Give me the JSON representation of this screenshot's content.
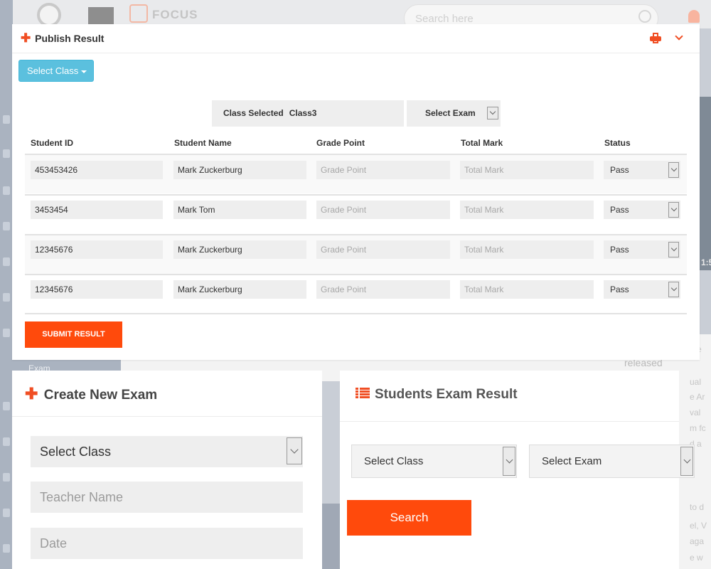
{
  "background": {
    "logo_text": "FOCUS",
    "search_placeholder": "Search here",
    "sidebar_exam_label": "Exam",
    "clock_fragment": "1:5",
    "partial_word": "released",
    "right_column_lines": [
      "nte",
      "ual",
      "e Ar",
      "val",
      "m fc",
      "d a",
      "to d",
      "el, V",
      "aga",
      "e w"
    ]
  },
  "publish_result": {
    "title": "Publish Result",
    "select_class_button": "Select Class",
    "class_selected_label": "Class Selected",
    "class_selected_value": "Class3",
    "select_exam_label": "Select Exam",
    "columns": [
      "Student ID",
      "Student Name",
      "Grade Point",
      "Total Mark",
      "Status"
    ],
    "grade_placeholder": "Grade Point",
    "total_placeholder": "Total Mark",
    "rows": [
      {
        "student_id": "453453426",
        "student_name": "Mark Zuckerburg",
        "status": "Pass"
      },
      {
        "student_id": "3453454",
        "student_name": "Mark Tom",
        "status": "Pass"
      },
      {
        "student_id": "12345676",
        "student_name": "Mark Zuckerburg",
        "status": "Pass"
      },
      {
        "student_id": "12345676",
        "student_name": "Mark Zuckerburg",
        "status": "Pass"
      }
    ],
    "submit_label": "SUBMIT RESULT"
  },
  "create_exam": {
    "title": "Create New Exam",
    "select_class": "Select Class",
    "teacher_placeholder": "Teacher Name",
    "date_placeholder": "Date"
  },
  "exam_result": {
    "title": "Students Exam Result",
    "select_class": "Select Class",
    "select_exam": "Select Exam",
    "search_label": "Search"
  },
  "colors": {
    "accent": "#f04e23",
    "button_orange": "#ff4a0c",
    "info_button": "#5bc0de"
  }
}
